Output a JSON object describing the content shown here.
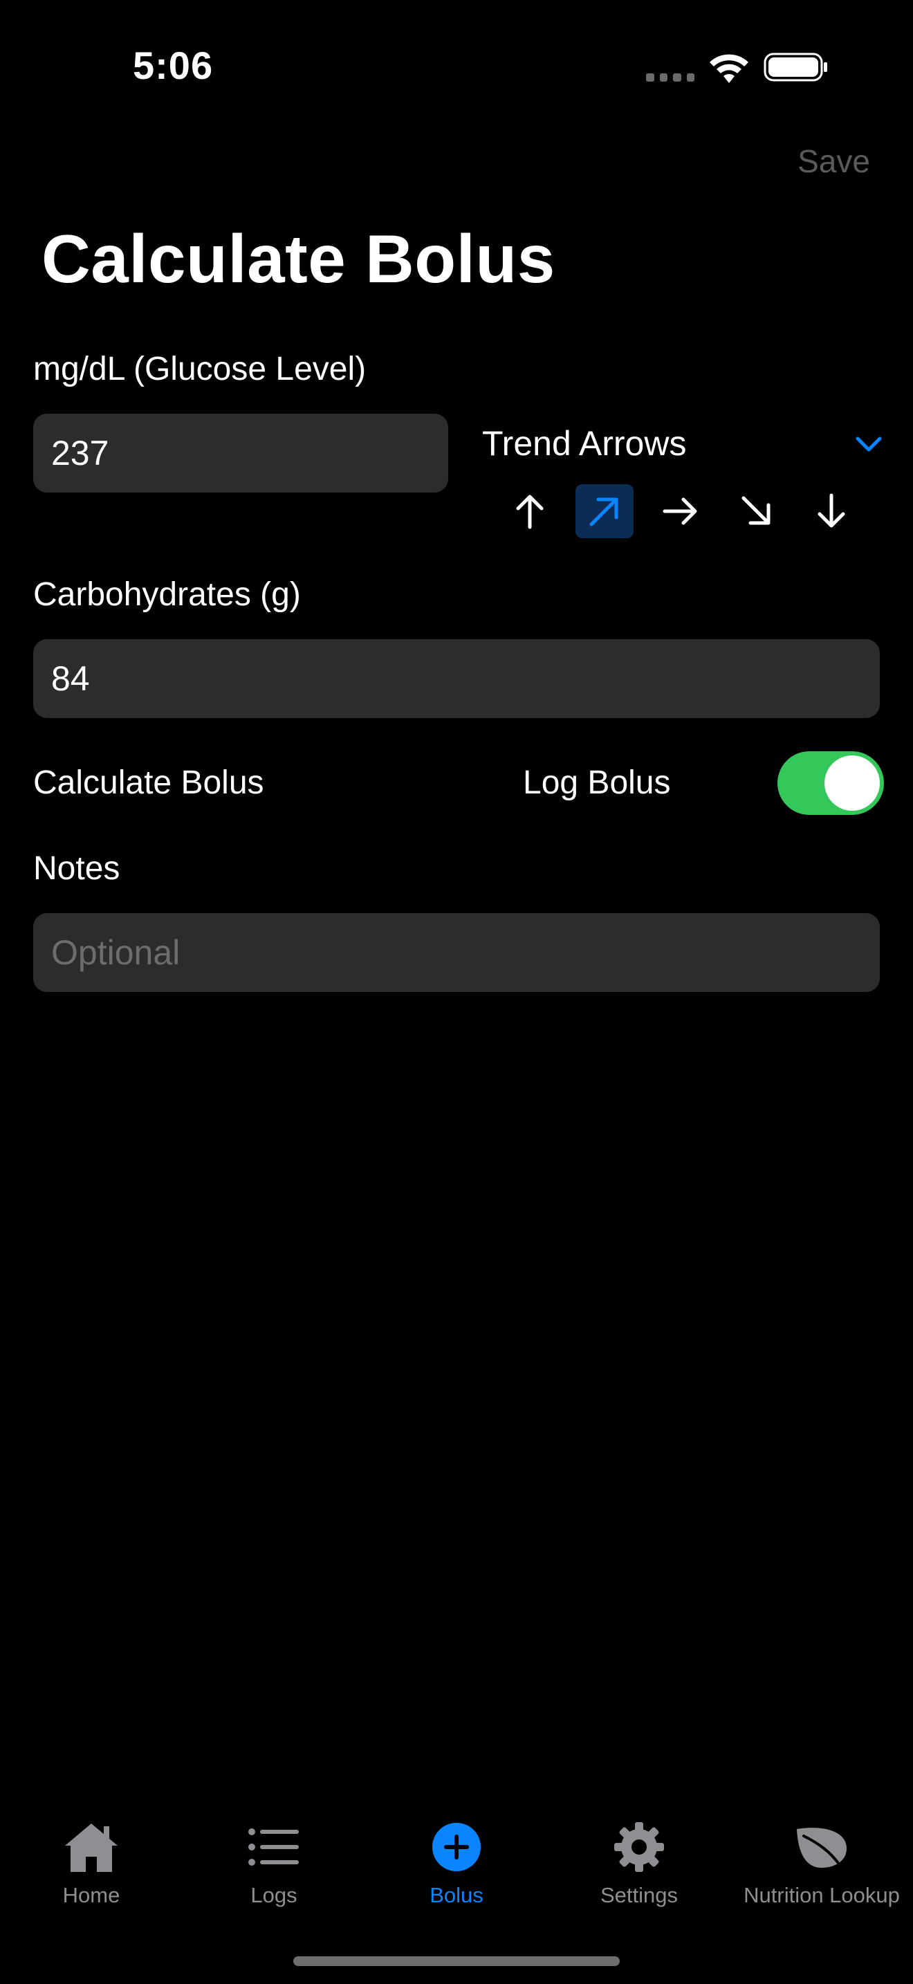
{
  "status_bar": {
    "time": "5:06"
  },
  "nav": {
    "save_label": "Save",
    "title": "Calculate Bolus"
  },
  "glucose": {
    "label": "mg/dL (Glucose Level)",
    "value": "237"
  },
  "trend": {
    "label": "Trend Arrows",
    "arrows": [
      "up",
      "up-right",
      "right",
      "down-right",
      "down"
    ],
    "selected": "up-right"
  },
  "carbs": {
    "label": "Carbohydrates (g)",
    "value": "84"
  },
  "bolus": {
    "calculate_label": "Calculate Bolus",
    "log_label": "Log Bolus",
    "log_enabled": true
  },
  "notes": {
    "label": "Notes",
    "placeholder": "Optional"
  },
  "tabs": [
    {
      "label": "Home",
      "icon": "house-icon",
      "active": false
    },
    {
      "label": "Logs",
      "icon": "list-icon",
      "active": false
    },
    {
      "label": "Bolus",
      "icon": "plus-circle-icon",
      "active": true
    },
    {
      "label": "Settings",
      "icon": "gear-icon",
      "active": false
    },
    {
      "label": "Nutrition Lookup",
      "icon": "leaf-icon",
      "active": false
    }
  ],
  "colors": {
    "accent": "#0a84ff",
    "toggle_on": "#34c759",
    "field_bg": "#2c2c2e",
    "selected_arrow_bg": "#0b2d55",
    "inactive": "#8e8e93"
  }
}
